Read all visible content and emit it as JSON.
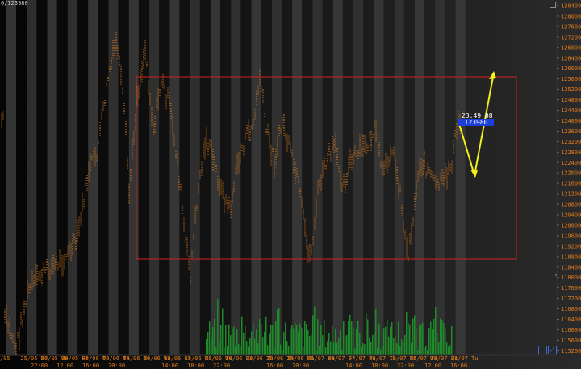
{
  "header": {
    "symbol_value": "0/123980"
  },
  "cursor": {
    "time_label": "23:49:08",
    "price_label": "123980"
  },
  "y_axis": {
    "labels": [
      "128400",
      "128000",
      "127600",
      "127200",
      "126800",
      "126400",
      "126000",
      "125600",
      "125200",
      "124800",
      "124400",
      "124000",
      "123600",
      "123200",
      "122800",
      "122400",
      "122000",
      "121600",
      "121200",
      "120800",
      "120400",
      "120000",
      "119600",
      "119200",
      "118800",
      "118400",
      "118000",
      "117600",
      "117200",
      "116800",
      "116400",
      "116000",
      "115600",
      "115200"
    ]
  },
  "x_axis": {
    "date_labels": [
      "/05",
      "25/05 Mo",
      "27/05 We",
      "29/05 Fr",
      "02/06 Tu",
      "04/06 Th",
      "08/06 Mo",
      "10/06 We",
      "12/06 Fr",
      "15/06 Mo",
      "17/06 We",
      "19/06 Fr",
      "23/06 Tu",
      "25/06 Th",
      "29/06 Mo",
      "01/07 We",
      "03/07 Fr",
      "07/07 Tu",
      "09/07 Th",
      "13/07 Mo",
      "15/07 We",
      "17/07 Fr",
      "21/07 Tu"
    ],
    "date_labels_top": [
      "Th",
      "",
      "",
      "",
      "",
      "",
      "",
      "",
      "",
      "",
      "",
      "",
      "",
      "",
      "",
      "30/06 Tu",
      "",
      "",
      "",
      "",
      "",
      "",
      ""
    ],
    "time_labels": [
      "22:00",
      "12:00",
      "16:00",
      "20:00",
      "14:00",
      "18:00",
      "22:00",
      "16:00",
      "20:00",
      "14:00",
      "18:00",
      "22:00",
      "12:00",
      "16:00"
    ]
  },
  "colors": {
    "candles": "#d87a1e",
    "volume": "#1f8a2a",
    "box": "#d21e1e",
    "arrow": "#f2f21c",
    "axis_text": "#e07b1e",
    "time_text": "#e07b1e",
    "date_text": "#e07b1e",
    "price_badge": "#1c3fd9"
  },
  "toolbar": {
    "icons": [
      "grid-icon",
      "window-icon",
      "expand-icon"
    ]
  }
}
